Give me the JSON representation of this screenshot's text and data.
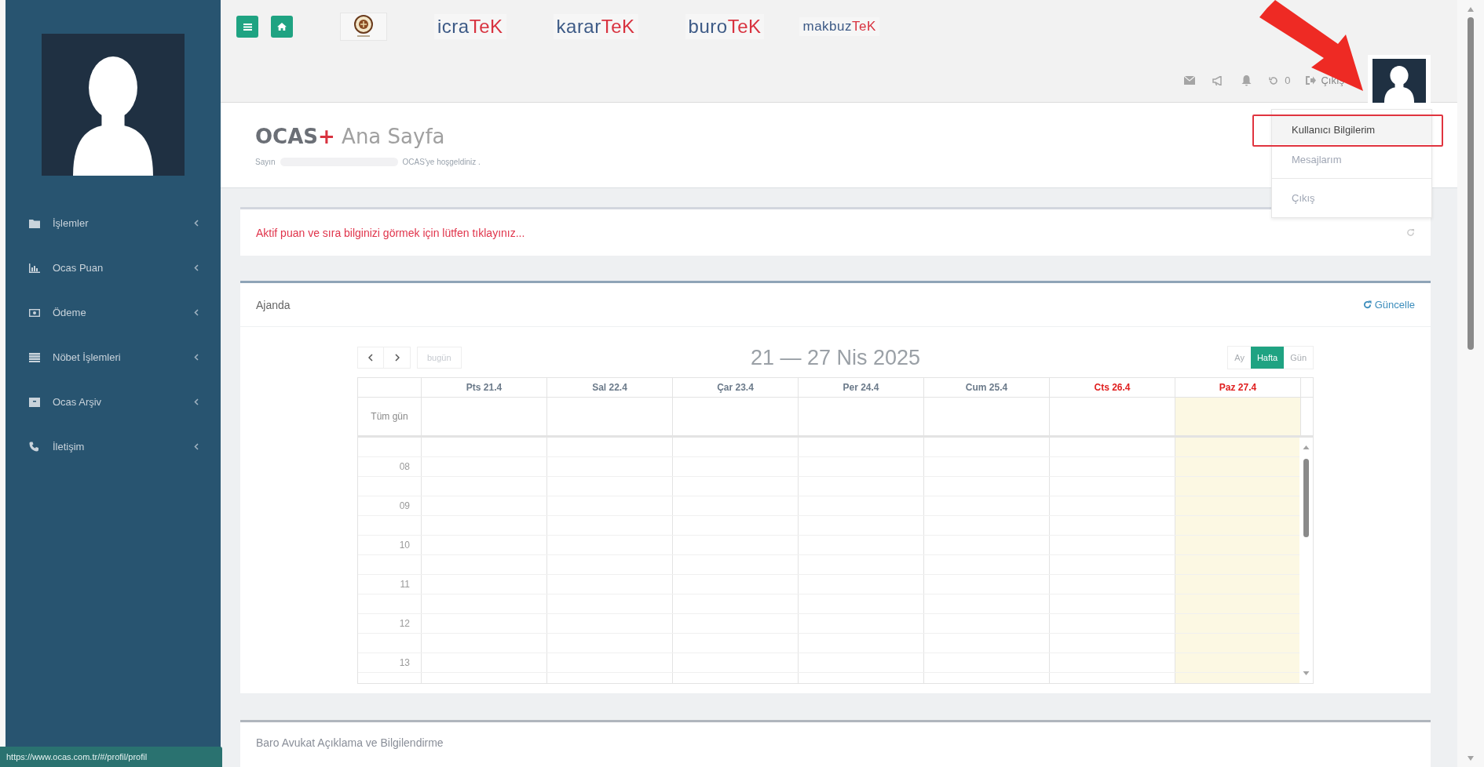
{
  "sidebar": {
    "menu": [
      {
        "label": "İşlemler"
      },
      {
        "label": "Ocas Puan"
      },
      {
        "label": "Ödeme"
      },
      {
        "label": "Nöbet İşlemleri"
      },
      {
        "label": "Ocas Arşiv"
      },
      {
        "label": "İletişim"
      }
    ]
  },
  "top_bar": {
    "logos": [
      {
        "text": "icra",
        "accent": "TeK"
      },
      {
        "text": "karar",
        "accent": "TeK"
      },
      {
        "text": "buro",
        "accent": "TeK"
      },
      {
        "text": "makbuz",
        "accent": "TeK"
      }
    ],
    "counter": "0",
    "logout": "Çıkış"
  },
  "user_menu": {
    "items": [
      {
        "label": "Kullanıcı Bilgilerim",
        "highlighted": true
      },
      {
        "label": "Mesajlarım",
        "highlighted": false
      },
      {
        "label": "Çıkış",
        "highlighted": false
      }
    ]
  },
  "page_header": {
    "brand": "OCAS",
    "brand_mark": "+",
    "title": "Ana Sayfa",
    "greeting_start": "Sayın",
    "greeting_end": "OCAS'ye hoşgeldiniz ."
  },
  "alert": {
    "text": "Aktif puan ve sıra bilginizi görmek için lütfen tıklayınız..."
  },
  "agenda": {
    "title": "Ajanda",
    "refresh": "Güncelle",
    "today_button": {
      "label": "bugün",
      "disabled": true
    },
    "range": "21 — 27 Nis 2025",
    "views": [
      {
        "label": "Ay",
        "selected": false
      },
      {
        "label": "Hafta",
        "selected": true
      },
      {
        "label": "Gün",
        "selected": false
      }
    ],
    "all_day": "Tüm gün",
    "days": [
      {
        "label": "Pts 21.4",
        "weekend": false,
        "today": false
      },
      {
        "label": "Sal 22.4",
        "weekend": false,
        "today": false
      },
      {
        "label": "Çar 23.4",
        "weekend": false,
        "today": false
      },
      {
        "label": "Per 24.4",
        "weekend": false,
        "today": false
      },
      {
        "label": "Cum 25.4",
        "weekend": false,
        "today": false
      },
      {
        "label": "Cts 26.4",
        "weekend": true,
        "today": false
      },
      {
        "label": "Paz 27.4",
        "weekend": true,
        "today": true
      }
    ],
    "hours": [
      "08",
      "09",
      "10",
      "11",
      "12",
      "13"
    ]
  },
  "info_panel": {
    "title": "Baro Avukat Açıklama ve Bilgilendirme"
  },
  "status_url": "https://www.ocas.com.tr/#/profil/profil"
}
